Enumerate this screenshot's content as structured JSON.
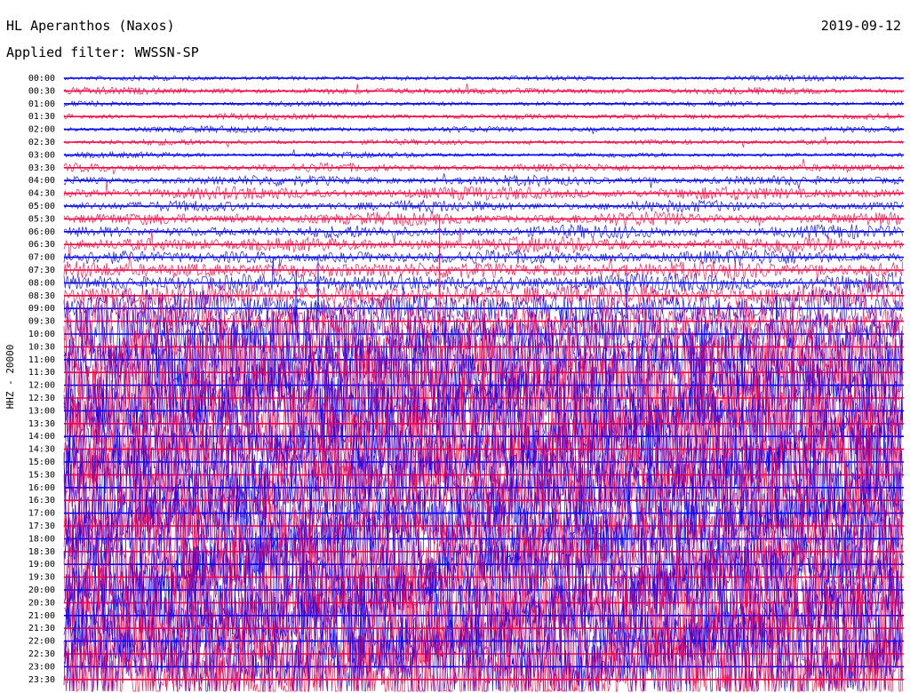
{
  "header": {
    "station": "HL Aperanthos (Naxos)",
    "date": "2019-09-12",
    "filter_label": "Applied filter:",
    "filter_value": "WWSSN-SP"
  },
  "chart_data": {
    "type": "line",
    "title": "HL Aperanthos (Naxos)",
    "subtitle": "Applied filter: WWSSN-SP",
    "xlabel": "",
    "ylabel": "HHZ - 20000",
    "row_interval_minutes": 30,
    "row_labels": [
      "00:00",
      "00:30",
      "01:00",
      "01:30",
      "02:00",
      "02:30",
      "03:00",
      "03:30",
      "04:00",
      "04:30",
      "05:00",
      "05:30",
      "06:00",
      "06:30",
      "07:00",
      "07:30",
      "08:00",
      "08:30",
      "09:00",
      "09:30",
      "10:00",
      "10:30",
      "11:00",
      "11:30",
      "12:00",
      "12:30",
      "13:00",
      "13:30",
      "14:00",
      "14:30",
      "15:00",
      "15:30",
      "16:00",
      "16:30",
      "17:00",
      "17:30",
      "18:00",
      "18:30",
      "19:00",
      "19:30",
      "20:00",
      "20:30",
      "21:00",
      "21:30",
      "22:00",
      "22:30",
      "23:00",
      "23:30"
    ],
    "trace_colors": [
      "#0000ff",
      "#ff0040"
    ],
    "grid": false,
    "legend": "none",
    "activity_level_0to1": [
      0.04,
      0.06,
      0.04,
      0.05,
      0.05,
      0.04,
      0.04,
      0.07,
      0.09,
      0.12,
      0.1,
      0.12,
      0.12,
      0.15,
      0.14,
      0.18,
      0.2,
      0.28,
      0.38,
      0.5,
      0.62,
      0.75,
      0.9,
      1.0,
      1.0,
      1.0,
      1.0,
      1.0,
      1.0,
      1.0,
      1.0,
      1.0,
      1.0,
      1.0,
      0.95,
      0.6,
      1.0,
      1.0,
      1.0,
      1.0,
      1.0,
      1.0,
      1.0,
      1.0,
      1.0,
      1.0,
      1.0,
      1.0
    ]
  }
}
